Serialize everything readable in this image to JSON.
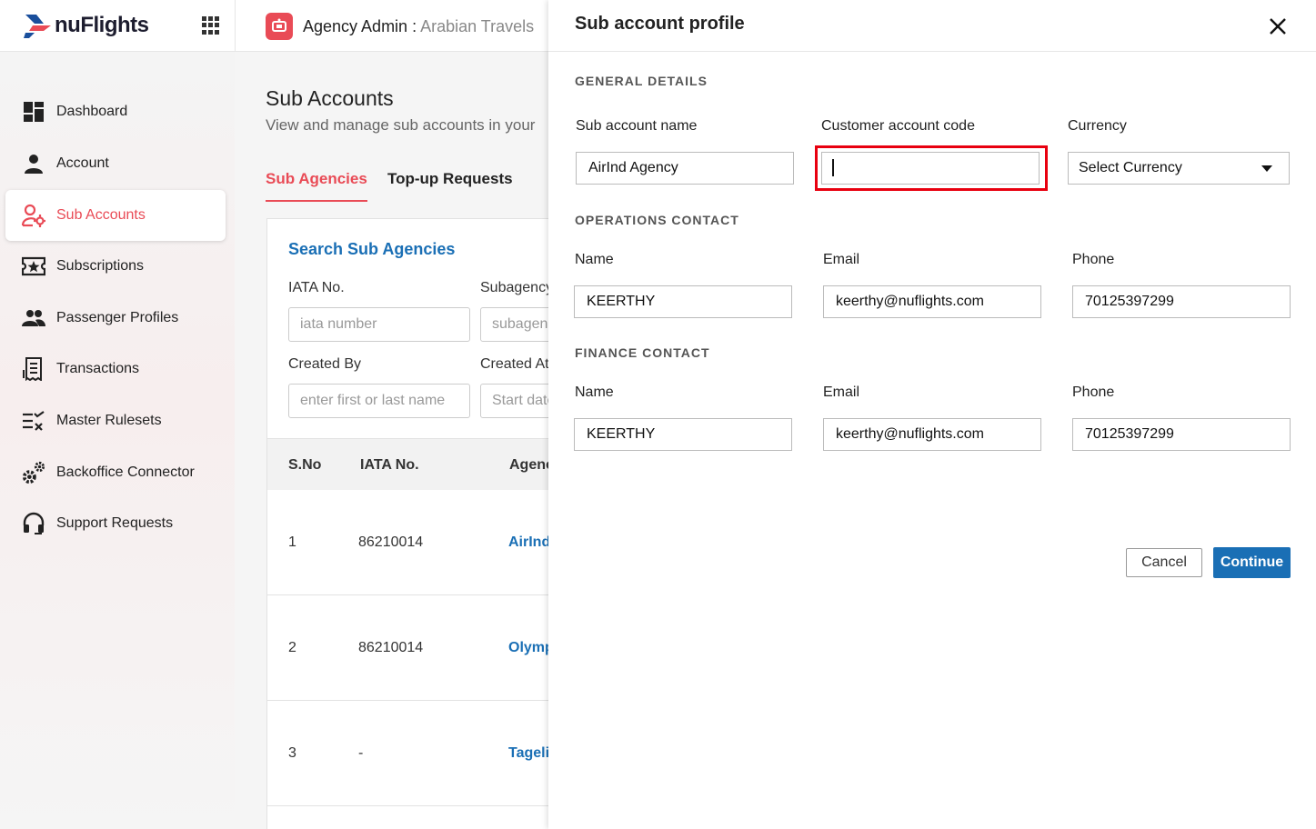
{
  "brand": {
    "name": "nuFlights",
    "accent": "#e94b56",
    "link": "#1a6fb5"
  },
  "header": {
    "title_label": "Agency Admin :",
    "agency_name": "Arabian Travels"
  },
  "sidebar": {
    "items": [
      {
        "label": "Dashboard",
        "icon": "dashboard-icon"
      },
      {
        "label": "Account",
        "icon": "person-icon"
      },
      {
        "label": "Sub Accounts",
        "icon": "sub-accounts-icon",
        "active": true
      },
      {
        "label": "Subscriptions",
        "icon": "ticket-star-icon"
      },
      {
        "label": "Passenger Profiles",
        "icon": "people-icon"
      },
      {
        "label": "Transactions",
        "icon": "receipt-icon"
      },
      {
        "label": "Master Rulesets",
        "icon": "rules-icon"
      },
      {
        "label": "Backoffice Connector",
        "icon": "gears-icon"
      },
      {
        "label": "Support Requests",
        "icon": "headset-icon"
      }
    ]
  },
  "main": {
    "title": "Sub Accounts",
    "subtitle": "View and manage sub accounts in your",
    "tabs": [
      {
        "label": "Sub Agencies",
        "active": true
      },
      {
        "label": "Top-up Requests"
      }
    ],
    "search": {
      "title": "Search Sub Agencies",
      "iata_label": "IATA No.",
      "iata_placeholder": "iata number",
      "subagency_label": "Subagency",
      "subagency_placeholder": "subagenc",
      "created_by_label": "Created By",
      "created_by_placeholder": "enter first or last name",
      "created_at_label": "Created At",
      "created_at_placeholder": "Start date"
    },
    "table": {
      "headers": [
        "S.No",
        "IATA No.",
        "Agenc"
      ],
      "rows": [
        {
          "sno": "1",
          "iata": "86210014",
          "agency": "AirInd"
        },
        {
          "sno": "2",
          "iata": "86210014",
          "agency": "Olymp"
        },
        {
          "sno": "3",
          "iata": "-",
          "agency": "Tageli"
        }
      ]
    }
  },
  "panel": {
    "title": "Sub account profile",
    "general": {
      "heading": "GENERAL DETAILS",
      "name_label": "Sub account name",
      "name_value": "AirInd Agency",
      "code_label": "Customer account code",
      "code_value": "",
      "currency_label": "Currency",
      "currency_value": "Select Currency"
    },
    "operations": {
      "heading": "OPERATIONS CONTACT",
      "name_label": "Name",
      "name_value": "KEERTHY",
      "email_label": "Email",
      "email_value": "keerthy@nuflights.com",
      "phone_label": "Phone",
      "phone_value": "70125397299"
    },
    "finance": {
      "heading": "FINANCE CONTACT",
      "name_label": "Name",
      "name_value": "KEERTHY",
      "email_label": "Email",
      "email_value": "keerthy@nuflights.com",
      "phone_label": "Phone",
      "phone_value": "70125397299"
    },
    "cancel_label": "Cancel",
    "continue_label": "Continue"
  }
}
